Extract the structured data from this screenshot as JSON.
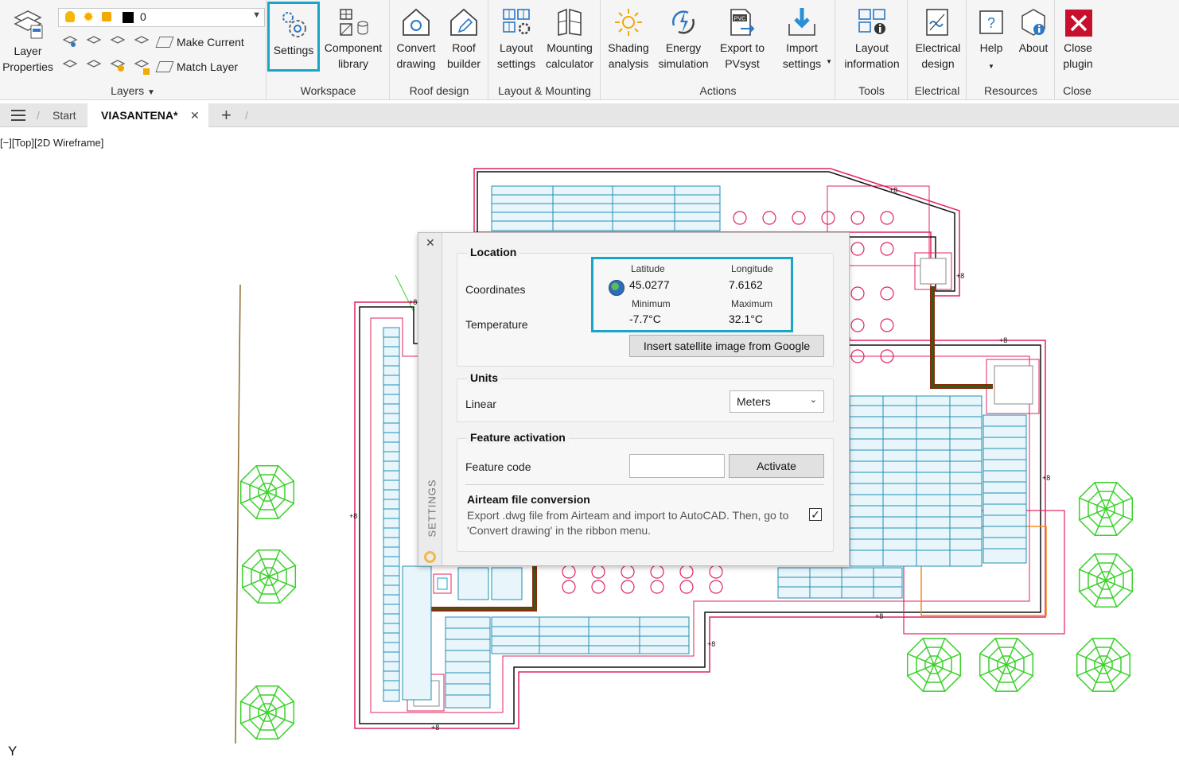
{
  "ribbon": {
    "layers": {
      "layer_properties": "Layer\nProperties",
      "layer_value": "0",
      "make_current": "Make Current",
      "match_layer": "Match Layer",
      "group_label": "Layers"
    },
    "workspace": {
      "settings": "Settings",
      "component_library": "Component\nlibrary",
      "group_label": "Workspace"
    },
    "roof_design": {
      "convert_drawing": "Convert\ndrawing",
      "roof_builder": "Roof\nbuilder",
      "group_label": "Roof design"
    },
    "layout_mounting": {
      "layout_settings": "Layout\nsettings",
      "mounting_calculator": "Mounting\ncalculator",
      "group_label": "Layout & Mounting"
    },
    "actions": {
      "shading_analysis": "Shading\nanalysis",
      "energy_simulation": "Energy\nsimulation",
      "export_pvsyst": "Export to\nPVsyst",
      "import_settings": "Import\nsettings",
      "pvc_badge": "PVC",
      "group_label": "Actions"
    },
    "tools": {
      "layout_information": "Layout\ninformation",
      "group_label": "Tools"
    },
    "electrical": {
      "electrical_design": "Electrical\ndesign",
      "group_label": "Electrical"
    },
    "resources": {
      "help": "Help",
      "about": "About",
      "group_label": "Resources"
    },
    "close": {
      "close_plugin": "Close\nplugin",
      "group_label": "Close"
    }
  },
  "tabs": {
    "start": "Start",
    "active": "VIASANTENA*",
    "close_glyph": "✕",
    "add_glyph": "+"
  },
  "viewport_label": "[−][Top][2D Wireframe]",
  "axis_label": "Y",
  "drawing": {
    "level_mark": "+8"
  },
  "settings_panel": {
    "side_title": "SETTINGS",
    "close_glyph": "✕",
    "location": {
      "title": "Location",
      "coordinates_label": "Coordinates",
      "temperature_label": "Temperature",
      "latitude_caption": "Latitude",
      "latitude_value": "45.0277",
      "longitude_caption": "Longitude",
      "longitude_value": "7.6162",
      "minimum_caption": "Minimum",
      "minimum_value": "-7.7°C",
      "maximum_caption": "Maximum",
      "maximum_value": "32.1°C",
      "satellite_button": "Insert satellite image from Google"
    },
    "units": {
      "title": "Units",
      "linear_label": "Linear",
      "linear_value": "Meters"
    },
    "feature_activation": {
      "title": "Feature activation",
      "feature_code_label": "Feature code",
      "feature_code_value": "",
      "activate_button": "Activate",
      "airteam_title": "Airteam file conversion",
      "airteam_desc": "Export .dwg file from Airteam and import to AutoCAD. Then, go to 'Convert drawing' in the ribbon menu.",
      "airteam_checked": true
    }
  },
  "colors": {
    "highlight": "#1aa4c8",
    "panel_fill": "#1f8fb5",
    "roof_edge": "#e0245e",
    "tree": "#3ad12b",
    "cable": "#8a2b0d",
    "close_red": "#c8102e"
  }
}
